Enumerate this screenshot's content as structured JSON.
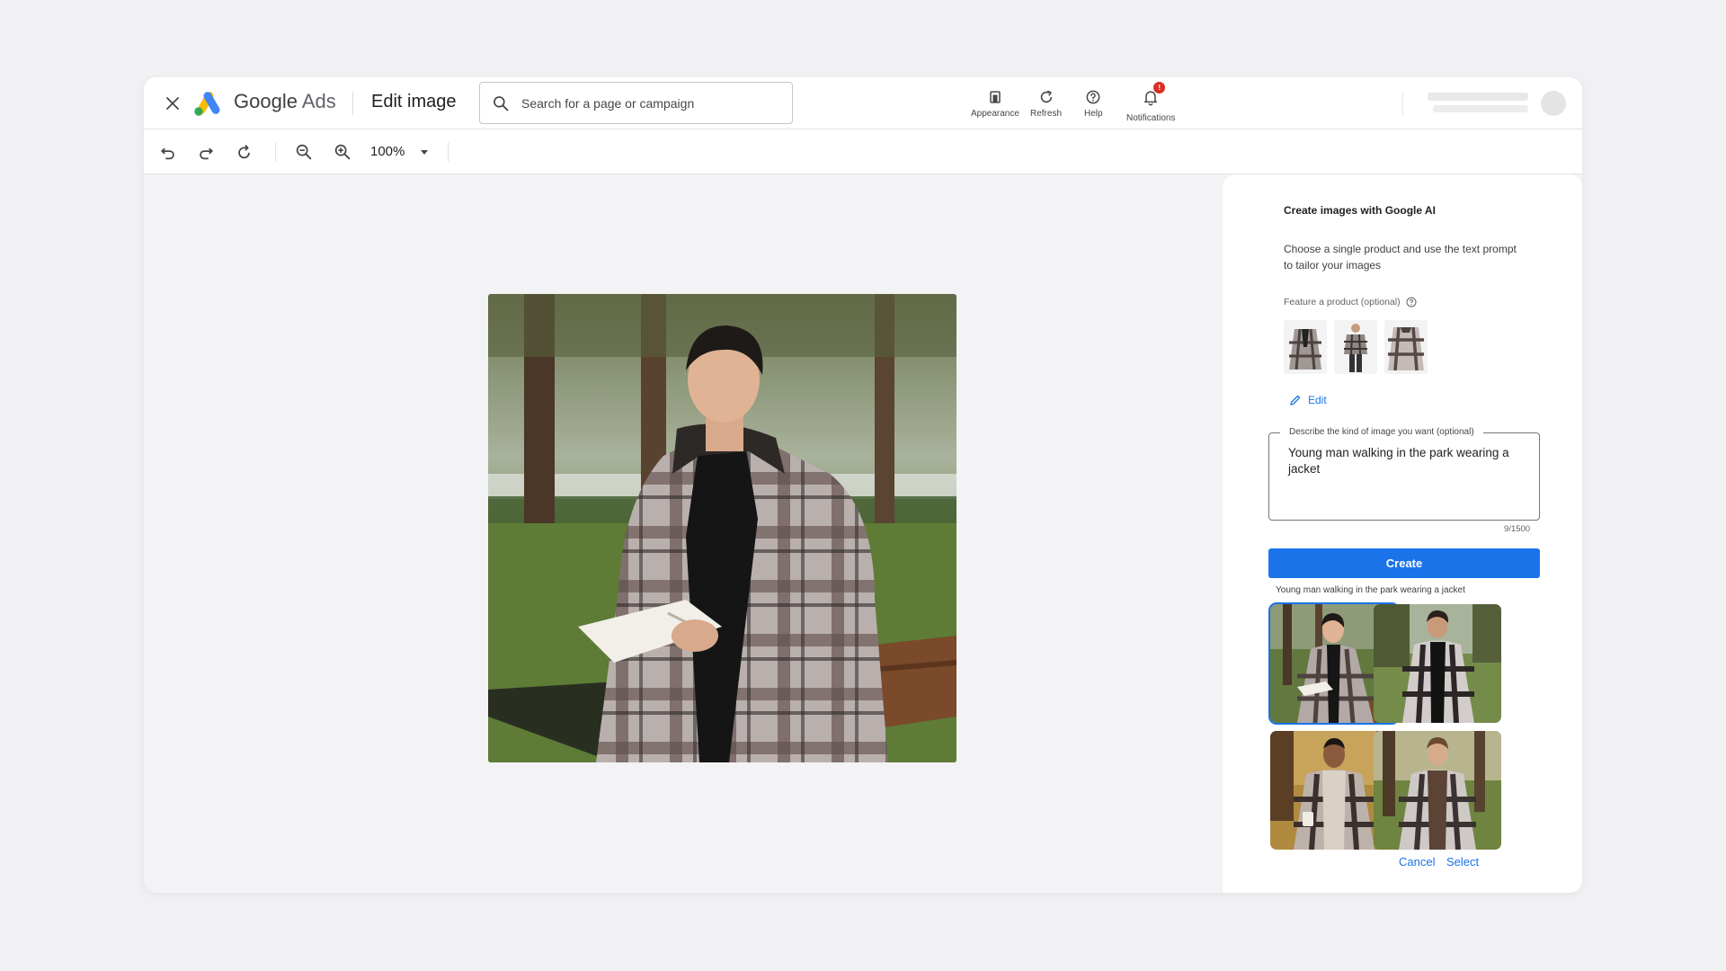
{
  "header": {
    "brand_google": "Google",
    "brand_ads": "Ads",
    "page_title": "Edit image",
    "search": {
      "placeholder": "Search for a page or campaign",
      "value": ""
    },
    "actions": [
      {
        "label": "Appearance",
        "icon": "appearance-icon"
      },
      {
        "label": "Refresh",
        "icon": "refresh-icon"
      },
      {
        "label": "Help",
        "icon": "help-icon"
      },
      {
        "label": "Notifications",
        "icon": "bell-icon",
        "badge": "!"
      }
    ]
  },
  "toolbar": {
    "zoom": "100%",
    "tools": [
      "undo-icon",
      "redo-icon",
      "rotate-icon",
      "zoom-out-icon",
      "zoom-in-icon"
    ]
  },
  "panel": {
    "title": "Create images with Google AI",
    "description": "Choose a single product and use the text prompt to tailor your images",
    "feature_label": "Feature a product (optional)",
    "edit_label": "Edit",
    "prompt_label": "Describe the kind of image you want (optional)",
    "prompt_value": "Young man walking in the park wearing a jacket",
    "char_count": "9/1500",
    "create_label": "Create",
    "result_caption": "Young man walking in the park wearing a jacket",
    "cancel_label": "Cancel",
    "select_label": "Select"
  },
  "colors": {
    "accent": "#1a73e8",
    "badge": "#d93025",
    "background": "#f3f2f5"
  }
}
